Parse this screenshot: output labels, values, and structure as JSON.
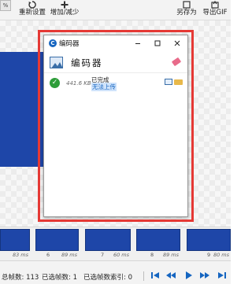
{
  "toolbar": {
    "left_button_label": "%",
    "reset_label": "重新设置",
    "increase_decrease_label": "增加/减少",
    "save_as_label": "另存为",
    "export_gif_label": "导出GIF"
  },
  "encoder_window": {
    "title": "编码器",
    "heading": "编码器",
    "job": {
      "size": "441.6 KB",
      "status": "已完成",
      "action_link": "无法上传"
    }
  },
  "frames": [
    {
      "number": "",
      "duration": "83 ms"
    },
    {
      "number": "6",
      "duration": "89 ms"
    },
    {
      "number": "7",
      "duration": "60 ms"
    },
    {
      "number": "8",
      "duration": "89 ms"
    },
    {
      "number": "9",
      "duration": "80 ms"
    }
  ],
  "status": {
    "total_frames": "总帧数: 113",
    "selected_frames": "已选帧数: 1",
    "selected_index": "已选帧数索引: 0"
  },
  "colors": {
    "highlight": "#e53935",
    "frame_blue": "#1e46a8",
    "link_blue": "#1565c0",
    "success_green": "#2e9d3a"
  }
}
